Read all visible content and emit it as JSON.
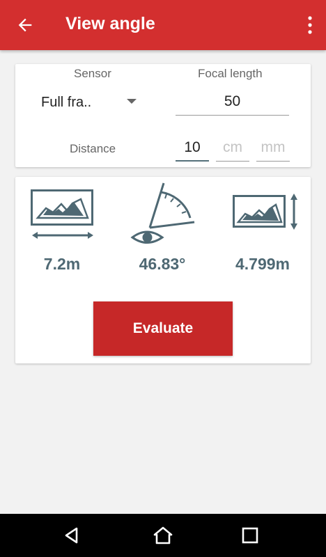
{
  "appbar": {
    "title": "View angle",
    "back_icon": "arrow-back-icon",
    "menu_icon": "more-vert-icon",
    "color": "#d32f2f"
  },
  "inputs": {
    "sensor_label": "Sensor",
    "sensor_value": "Full fra..",
    "focal_label": "Focal length",
    "focal_value": "50",
    "distance_label": "Distance",
    "distance_value": "10",
    "unit_cm": "cm",
    "unit_mm": "mm"
  },
  "results": {
    "width": "7.2m",
    "angle": "46.83°",
    "height": "4.799m",
    "icon_color": "#4e6873"
  },
  "actions": {
    "evaluate_label": "Evaluate",
    "evaluate_color": "#c62828"
  },
  "navbar": {
    "back_icon": "nav-back-icon",
    "home_icon": "nav-home-icon",
    "recents_icon": "nav-recents-icon"
  }
}
